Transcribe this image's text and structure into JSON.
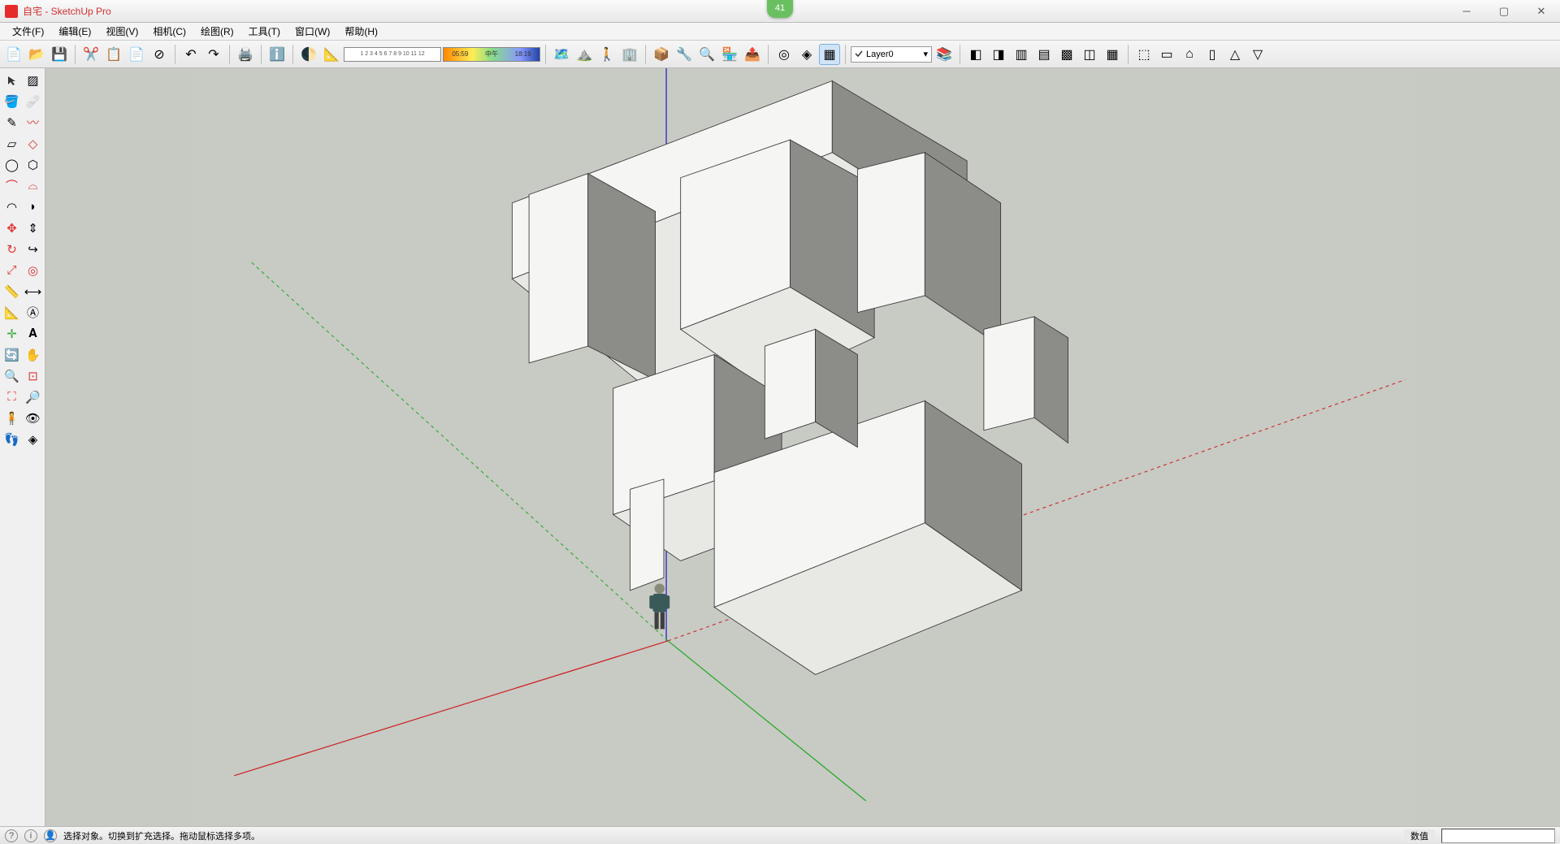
{
  "title": "自宅 - SketchUp Pro",
  "notification_badge": "41",
  "menu": {
    "file": "文件(F)",
    "edit": "编辑(E)",
    "view": "视图(V)",
    "camera": "相机(C)",
    "draw": "绘图(R)",
    "tools": "工具(T)",
    "window": "窗口(W)",
    "help": "帮助(H)"
  },
  "time_toolbar": {
    "ruler_marks": "1 2 3 4 5 6 7 8 9 10 11 12",
    "shadow_start": "05:59",
    "shadow_mid": "中午",
    "shadow_end": "18:19"
  },
  "layer": {
    "current": "Layer0"
  },
  "status": {
    "hint": "选择对象。切换到扩充选择。拖动鼠标选择多项。",
    "value_label": "数值"
  }
}
